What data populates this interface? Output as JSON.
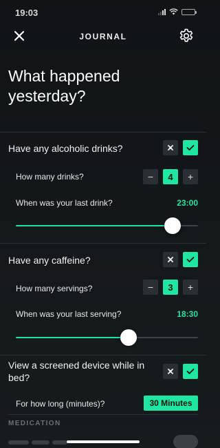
{
  "status": {
    "time": "19:03"
  },
  "nav": {
    "title": "JOURNAL"
  },
  "heading": "What happened yesterday?",
  "questions": [
    {
      "label": "Have any alcoholic drinks?",
      "answer": "yes",
      "count_label": "How many drinks?",
      "count": "4",
      "time_label": "When was your last drink?",
      "time": "23:00",
      "slider_fraction": 0.86
    },
    {
      "label": "Have any caffeine?",
      "answer": "yes",
      "count_label": "How many servings?",
      "count": "3",
      "time_label": "When was your last serving?",
      "time": "18:30",
      "slider_fraction": 0.62
    },
    {
      "label": "View a screened device while in bed?",
      "answer": "yes",
      "duration_label": "For how long (minutes)?",
      "duration": "30 Minutes"
    }
  ],
  "medication": {
    "header": "MEDICATION"
  },
  "colors": {
    "accent": "#1fe6a0",
    "accent_text": "#29e3a0",
    "background": "#141a1d",
    "button_dark": "#2a2f33"
  },
  "icons": {
    "close": "close-icon",
    "settings": "gear-icon",
    "no": "x-icon",
    "yes": "check-icon",
    "minus": "minus-icon",
    "plus": "plus-icon"
  }
}
